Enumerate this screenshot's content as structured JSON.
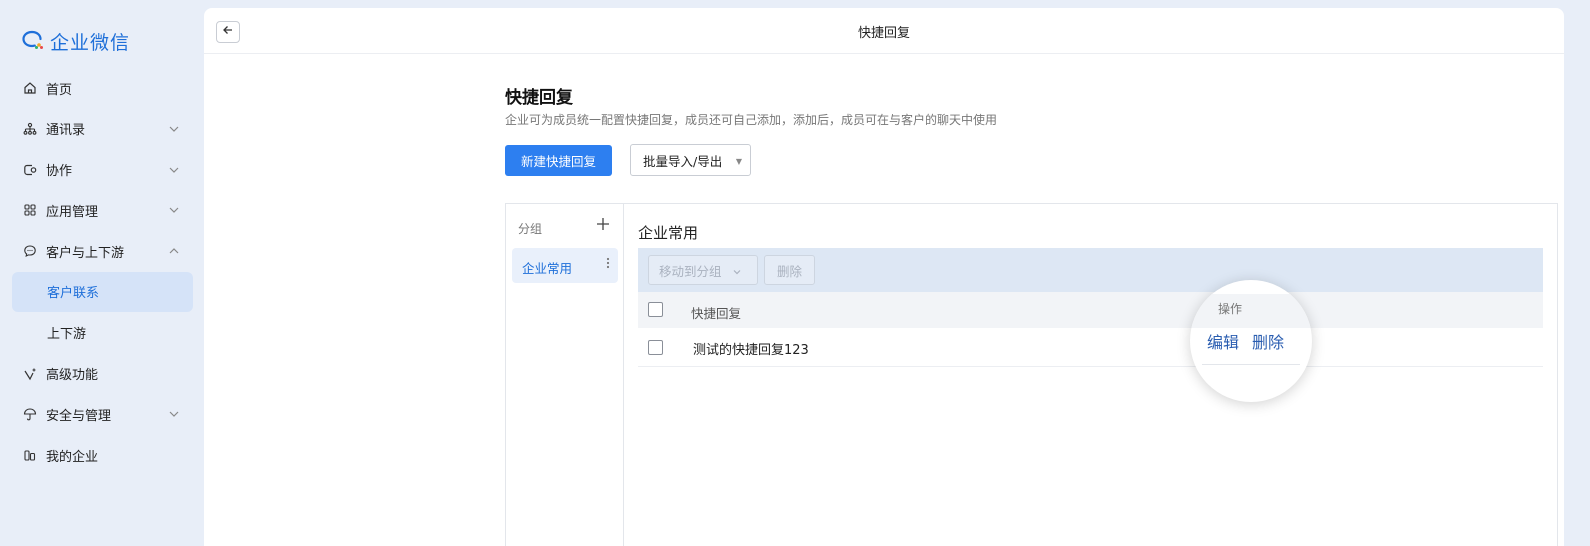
{
  "app": {
    "name": "企业微信",
    "brand_color": "#1e6fd9"
  },
  "sidebar": {
    "items": [
      {
        "label": "首页",
        "icon": "home-icon",
        "expandable": false
      },
      {
        "label": "通讯录",
        "icon": "org-tree-icon",
        "expandable": true
      },
      {
        "label": "协作",
        "icon": "collab-icon",
        "expandable": true
      },
      {
        "label": "应用管理",
        "icon": "apps-grid-icon",
        "expandable": true
      },
      {
        "label": "客户与上下游",
        "icon": "chat-bubble-icon",
        "expandable": true,
        "expanded": true
      },
      {
        "label": "客户联系",
        "sub": true,
        "active": true
      },
      {
        "label": "上下游",
        "sub": true
      },
      {
        "label": "高级功能",
        "icon": "sparkle-icon",
        "expandable": false
      },
      {
        "label": "安全与管理",
        "icon": "umbrella-icon",
        "expandable": true
      },
      {
        "label": "我的企业",
        "icon": "building-icon",
        "expandable": false
      }
    ]
  },
  "topbar": {
    "title": "快捷回复",
    "back_icon": "arrow-left-icon"
  },
  "page": {
    "title": "快捷回复",
    "description": "企业可为成员统一配置快捷回复，成员还可自己添加，添加后，成员可在与客户的聊天中使用",
    "new_button": "新建快捷回复",
    "import_export_button": "批量导入/导出"
  },
  "groups": {
    "header": "分组",
    "add_icon": "plus-icon",
    "items": [
      {
        "label": "企业常用",
        "more_icon": "more-vertical-icon"
      }
    ]
  },
  "content": {
    "title": "企业常用",
    "toolbar": {
      "move_to_group": "移动到分组",
      "delete": "删除"
    },
    "table": {
      "header": "快捷回复",
      "rows": [
        {
          "text": "测试的快捷回复123"
        }
      ]
    }
  },
  "magnifier": {
    "header": "操作",
    "edit": "编辑",
    "delete": "删除"
  }
}
